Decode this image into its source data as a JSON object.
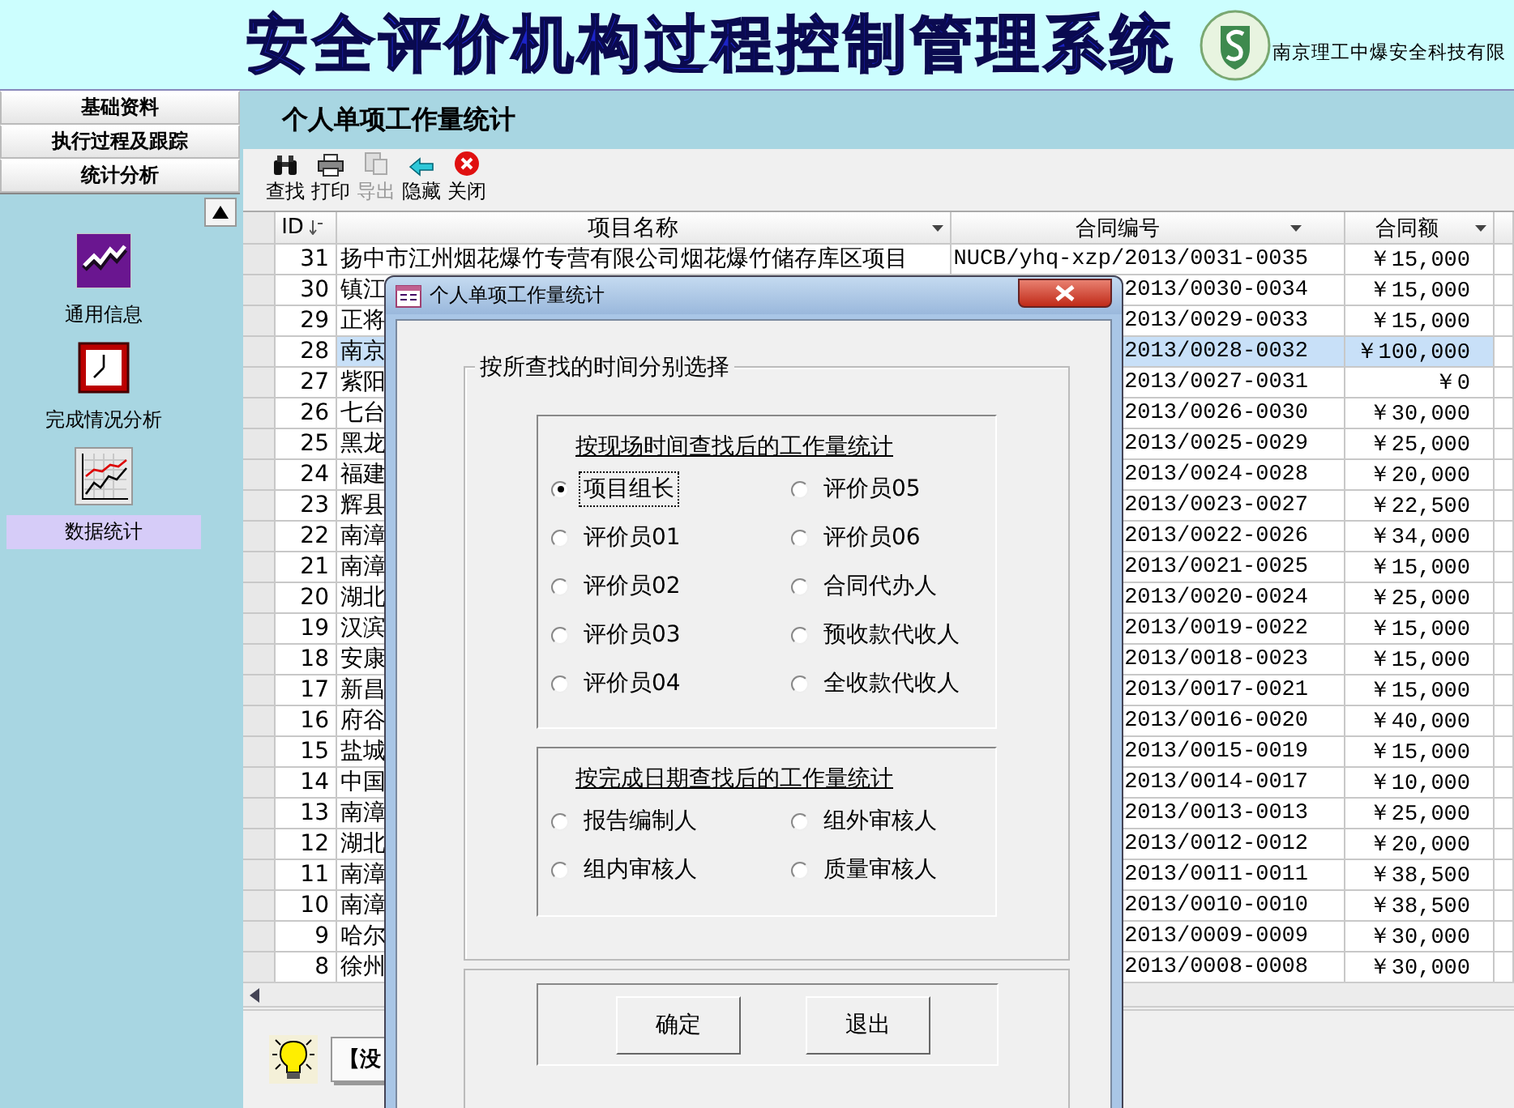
{
  "header": {
    "title": "安全评价机构过程控制管理系统",
    "company": "南京理工中爆安全科技有限"
  },
  "nav": [
    {
      "label": "基础资料"
    },
    {
      "label": "执行过程及跟踪"
    },
    {
      "label": "统计分析"
    }
  ],
  "sidebar": {
    "items": [
      {
        "label": "通用信息",
        "kind": "trend",
        "selected": false
      },
      {
        "label": "完成情况分析",
        "kind": "clock",
        "selected": false
      },
      {
        "label": "数据统计",
        "kind": "chart",
        "selected": true
      }
    ]
  },
  "page": {
    "title": "个人单项工作量统计"
  },
  "toolbar": [
    {
      "label": "查找",
      "kind": "find",
      "disabled": false
    },
    {
      "label": "打印",
      "kind": "print",
      "disabled": false
    },
    {
      "label": "导出",
      "kind": "export",
      "disabled": true
    },
    {
      "label": "隐藏",
      "kind": "hide",
      "disabled": false
    },
    {
      "label": "关闭",
      "kind": "close",
      "disabled": false
    }
  ],
  "table": {
    "columns": [
      "ID",
      "项目名称",
      "合同编号",
      "合同额"
    ],
    "rows": [
      {
        "id": "31",
        "name": "扬中市江州烟花爆竹专营有限公司烟花爆竹储存库区项目",
        "contract": "NUCB/yhq-xzp/2013/0031-0035",
        "amount": "￥15,000",
        "selected": false
      },
      {
        "id": "30",
        "name": "镇江",
        "contract": "2013/0030-0034",
        "amount": "￥15,000",
        "selected": false
      },
      {
        "id": "29",
        "name": "正将",
        "contract": "2013/0029-0033",
        "amount": "￥15,000",
        "selected": false
      },
      {
        "id": "28",
        "name": "南京",
        "contract": "2013/0028-0032",
        "amount": "￥100,000",
        "selected": true
      },
      {
        "id": "27",
        "name": "紫阳",
        "contract": "2013/0027-0031",
        "amount": "￥0",
        "selected": false
      },
      {
        "id": "26",
        "name": "七台",
        "contract": "2013/0026-0030",
        "amount": "￥30,000",
        "selected": false
      },
      {
        "id": "25",
        "name": "黑龙",
        "contract": "2013/0025-0029",
        "amount": "￥25,000",
        "selected": false
      },
      {
        "id": "24",
        "name": "福建",
        "contract": "2013/0024-0028",
        "amount": "￥20,000",
        "selected": false
      },
      {
        "id": "23",
        "name": "辉县",
        "contract": "2013/0023-0027",
        "amount": "￥22,500",
        "selected": false
      },
      {
        "id": "22",
        "name": "南漳",
        "contract": "2013/0022-0026",
        "amount": "￥34,000",
        "selected": false
      },
      {
        "id": "21",
        "name": "南漳",
        "contract": "2013/0021-0025",
        "amount": "￥15,000",
        "selected": false
      },
      {
        "id": "20",
        "name": "湖北",
        "contract": "2013/0020-0024",
        "amount": "￥25,000",
        "selected": false
      },
      {
        "id": "19",
        "name": "汉滨",
        "contract": "2013/0019-0022",
        "amount": "￥15,000",
        "selected": false
      },
      {
        "id": "18",
        "name": "安康",
        "contract": "2013/0018-0023",
        "amount": "￥15,000",
        "selected": false
      },
      {
        "id": "17",
        "name": "新昌",
        "contract": "2013/0017-0021",
        "amount": "￥15,000",
        "selected": false
      },
      {
        "id": "16",
        "name": "府谷",
        "contract": "2013/0016-0020",
        "amount": "￥40,000",
        "selected": false
      },
      {
        "id": "15",
        "name": "盐城",
        "contract": "2013/0015-0019",
        "amount": "￥15,000",
        "selected": false
      },
      {
        "id": "14",
        "name": "中国",
        "contract": "2013/0014-0017",
        "amount": "￥10,000",
        "selected": false
      },
      {
        "id": "13",
        "name": "南漳",
        "contract": "2013/0013-0013",
        "amount": "￥25,000",
        "selected": false
      },
      {
        "id": "12",
        "name": "湖北",
        "contract": "2013/0012-0012",
        "amount": "￥20,000",
        "selected": false
      },
      {
        "id": "11",
        "name": "南漳",
        "contract": "2013/0011-0011",
        "amount": "￥38,500",
        "selected": false
      },
      {
        "id": "10",
        "name": "南漳",
        "contract": "2013/0010-0010",
        "amount": "￥38,500",
        "selected": false
      },
      {
        "id": "9",
        "name": "哈尔",
        "contract": "2013/0009-0009",
        "amount": "￥30,000",
        "selected": false
      },
      {
        "id": "8",
        "name": "徐州",
        "contract": "2013/0008-0008",
        "amount": "￥30,000",
        "selected": false
      }
    ]
  },
  "status": {
    "message": "【没"
  },
  "dialog": {
    "title": "个人单项工作量统计",
    "group_title": "按所查找的时间分别选择",
    "sections": [
      {
        "heading": "按现场时间查找后的工作量统计",
        "options": [
          {
            "label": "项目组长",
            "selected": true
          },
          {
            "label": "评价员01",
            "selected": false
          },
          {
            "label": "评价员02",
            "selected": false
          },
          {
            "label": "评价员03",
            "selected": false
          },
          {
            "label": "评价员04",
            "selected": false
          },
          {
            "label": "评价员05",
            "selected": false
          },
          {
            "label": "评价员06",
            "selected": false
          },
          {
            "label": "合同代办人",
            "selected": false
          },
          {
            "label": "预收款代收人",
            "selected": false
          },
          {
            "label": "全收款代收人",
            "selected": false
          }
        ]
      },
      {
        "heading": "按完成日期查找后的工作量统计",
        "options": [
          {
            "label": "报告编制人",
            "selected": false
          },
          {
            "label": "组内审核人",
            "selected": false
          },
          {
            "label": "组外审核人",
            "selected": false
          },
          {
            "label": "质量审核人",
            "selected": false
          }
        ]
      }
    ],
    "buttons": [
      "确定",
      "退出"
    ]
  }
}
